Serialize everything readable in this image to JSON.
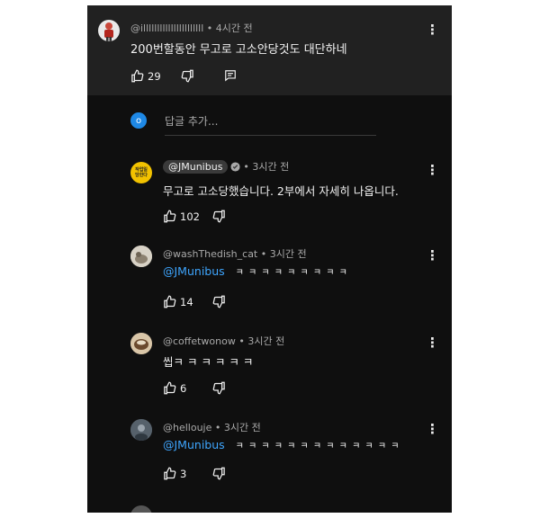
{
  "top_comment": {
    "author": "@illllllllllllllllllllll",
    "time": "• 4시간 전",
    "text": "200번할동안 무고로 고소안당것도 대단하네",
    "likes": "29"
  },
  "reply_box": {
    "avatar_letter": "o",
    "placeholder": "답글 추가..."
  },
  "replies": [
    {
      "author": "@JMunibus",
      "verified": true,
      "time": "• 3시간 전",
      "avatar_text": "작업일 당한다",
      "mention": "",
      "text": "무고로 고소당했습니다. 2부에서 자세히 나옵니다.",
      "likes": "102"
    },
    {
      "author": "@washThedish_cat",
      "verified": false,
      "time": "• 3시간 전",
      "mention": "@JMunibus",
      "text": "ㅋ ㅋ ㅋ ㅋ ㅋ ㅋ ㅋ ㅋ ㅋ",
      "likes": "14"
    },
    {
      "author": "@coffetwonow",
      "verified": false,
      "time": "• 3시간 전",
      "mention": "",
      "text": "씹ㅋ ㅋ ㅋ ㅋ ㅋ ㅋ",
      "likes": "6"
    },
    {
      "author": "@hellouje",
      "verified": false,
      "time": "• 3시간 전",
      "mention": "@JMunibus",
      "text": "ㅋ ㅋ ㅋ ㅋ ㅋ ㅋ ㅋ ㅋ ㅋ ㅋ ㅋ ㅋ ㅋ",
      "likes": "3"
    }
  ],
  "colors": {
    "accent": "#3ea6ff",
    "background": "#0f0f0f",
    "top_background": "#212121",
    "text": "#f1f1f1",
    "meta": "#aaaaaa"
  }
}
